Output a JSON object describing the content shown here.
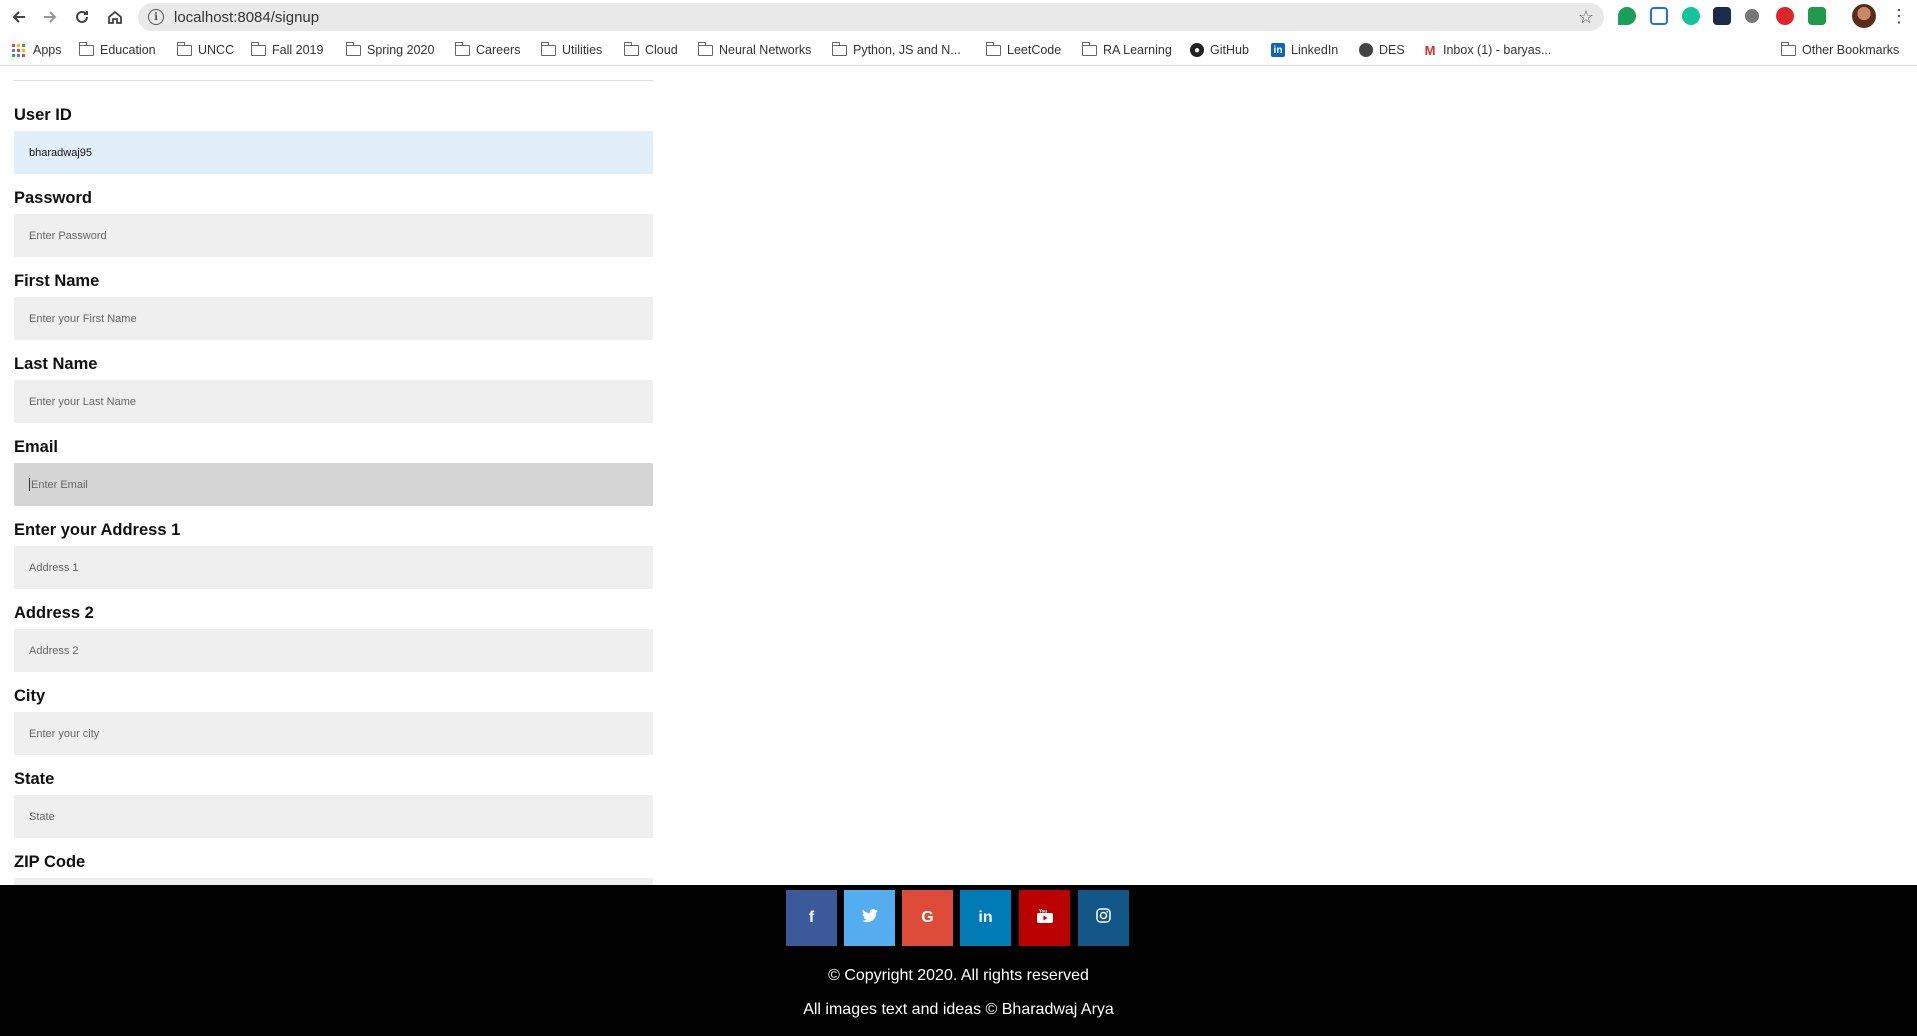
{
  "browser": {
    "url": "localhost:8084/signup",
    "bookmarks": [
      {
        "label": "Apps",
        "icon": "apps-grid-icon"
      },
      {
        "label": "Education",
        "icon": "folder-icon"
      },
      {
        "label": "UNCC",
        "icon": "folder-icon"
      },
      {
        "label": "Fall 2019",
        "icon": "folder-icon"
      },
      {
        "label": "Spring 2020",
        "icon": "folder-icon"
      },
      {
        "label": "Careers",
        "icon": "folder-icon"
      },
      {
        "label": "Utilities",
        "icon": "folder-icon"
      },
      {
        "label": "Cloud",
        "icon": "folder-icon"
      },
      {
        "label": "Neural Networks",
        "icon": "folder-icon"
      },
      {
        "label": "Python, JS and N...",
        "icon": "folder-icon"
      },
      {
        "label": "LeetCode",
        "icon": "folder-icon"
      },
      {
        "label": "RA Learning",
        "icon": "folder-icon"
      },
      {
        "label": "GitHub",
        "icon": "github-icon"
      },
      {
        "label": "LinkedIn",
        "icon": "linkedin-icon"
      },
      {
        "label": "DES",
        "icon": "globe-icon"
      },
      {
        "label": "Inbox (1) - baryas...",
        "icon": "gmail-icon"
      }
    ],
    "other_bookmarks": "Other Bookmarks"
  },
  "form": {
    "fields": [
      {
        "label": "User ID",
        "value": "bharadwaj95",
        "placeholder": ""
      },
      {
        "label": "Password",
        "value": "",
        "placeholder": "Enter Password"
      },
      {
        "label": "First Name",
        "value": "",
        "placeholder": "Enter your First Name"
      },
      {
        "label": "Last Name",
        "value": "",
        "placeholder": "Enter your Last Name"
      },
      {
        "label": "Email",
        "value": "",
        "placeholder": "Enter Email"
      },
      {
        "label": "Enter your Address 1",
        "value": "",
        "placeholder": "Address 1"
      },
      {
        "label": "Address 2",
        "value": "",
        "placeholder": "Address 2"
      },
      {
        "label": "City",
        "value": "",
        "placeholder": "Enter your city"
      },
      {
        "label": "State",
        "value": "",
        "placeholder": "State"
      },
      {
        "label": "ZIP Code",
        "value": "",
        "placeholder": ""
      }
    ]
  },
  "footer": {
    "social": [
      {
        "name": "facebook",
        "glyph": "f",
        "color": "#3b5998"
      },
      {
        "name": "twitter",
        "glyph": "🐦",
        "color": "#55acee"
      },
      {
        "name": "google",
        "glyph": "G",
        "color": "#dd4b39"
      },
      {
        "name": "linkedin",
        "glyph": "in",
        "color": "#007bb5"
      },
      {
        "name": "youtube",
        "glyph": "▶",
        "color": "#bb0000"
      },
      {
        "name": "instagram",
        "glyph": "◎",
        "color": "#125688"
      }
    ],
    "copyright": "© Copyright 2020. All rights reserved",
    "credit": "All images text and ideas © Bharadwaj Arya"
  }
}
